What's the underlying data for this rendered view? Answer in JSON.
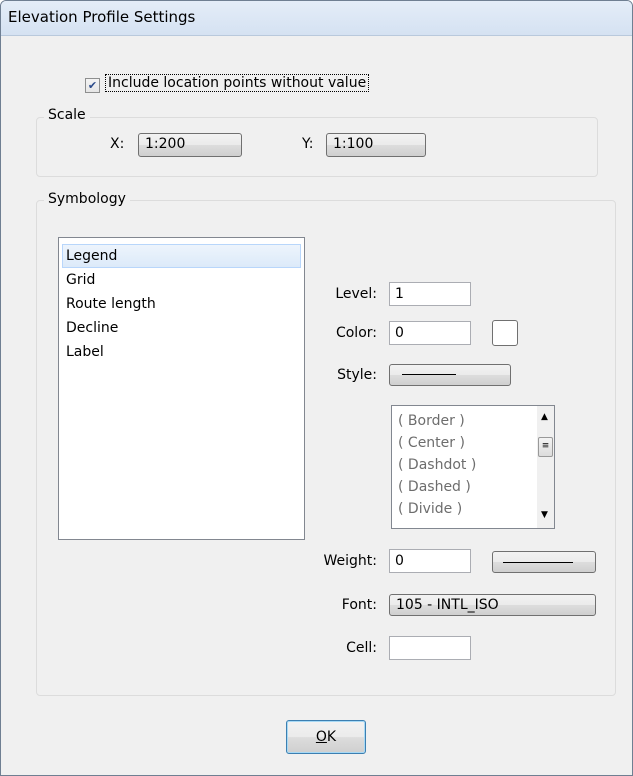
{
  "window": {
    "title": "Elevation Profile Settings"
  },
  "include_points": {
    "label": "Include location points without value",
    "checked": true
  },
  "scale": {
    "group_label": "Scale",
    "x_label": "X:",
    "x_value": "1:200",
    "y_label": "Y:",
    "y_value": "1:100"
  },
  "symbology": {
    "group_label": "Symbology",
    "items": [
      "Legend",
      "Grid",
      "Route length",
      "Decline",
      "Label"
    ],
    "selected_index": 0,
    "level_label": "Level:",
    "level_value": "1",
    "color_label": "Color:",
    "color_value": "0",
    "style_label": "Style:",
    "style_options": [
      "( Border )",
      "( Center )",
      "( Dashdot )",
      "( Dashed )",
      "( Divide )"
    ],
    "weight_label": "Weight:",
    "weight_value": "0",
    "font_label": "Font:",
    "font_value": "105 - INTL_ISO",
    "cell_label": "Cell:",
    "cell_value": ""
  },
  "ok_button": {
    "label": "OK",
    "accelerator": "O"
  }
}
